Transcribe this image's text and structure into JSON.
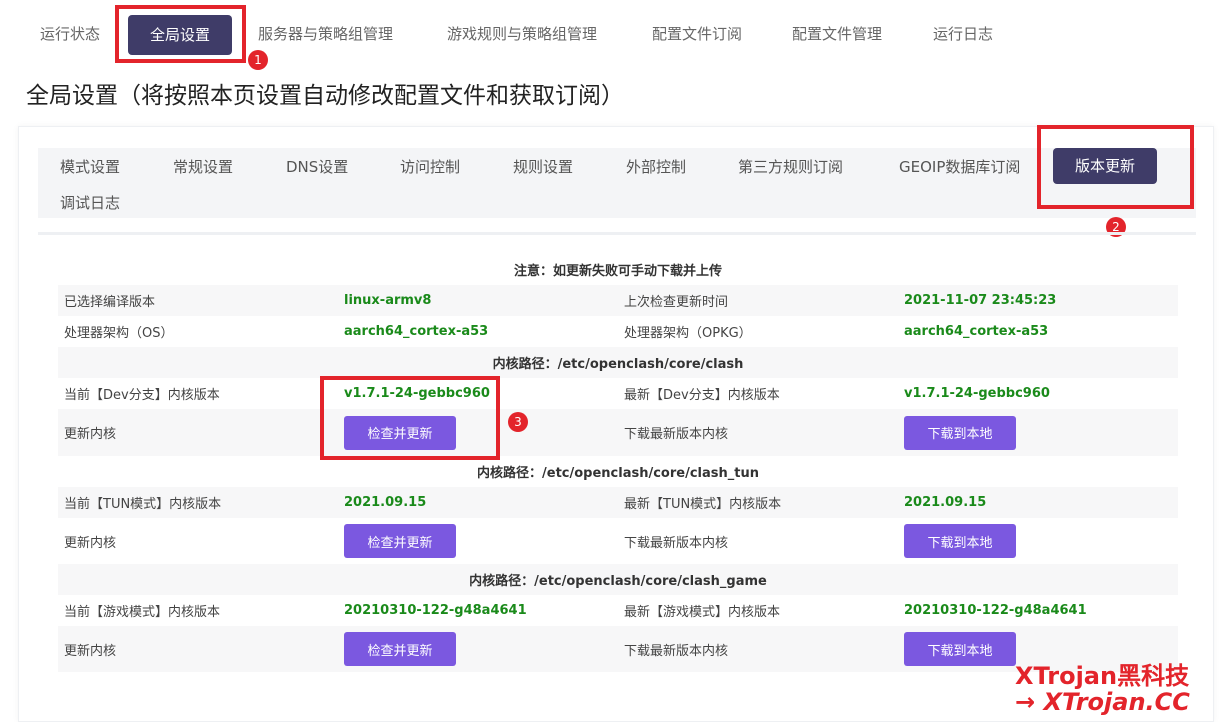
{
  "top_tabs": [
    "运行状态",
    "全局设置",
    "服务器与策略组管理",
    "游戏规则与策略组管理",
    "配置文件订阅",
    "配置文件管理",
    "运行日志"
  ],
  "top_tab_active": "全局设置",
  "page_title": "全局设置（将按照本页设置自动修改配置文件和获取订阅）",
  "sub_tabs": [
    "模式设置",
    "常规设置",
    "DNS设置",
    "访问控制",
    "规则设置",
    "外部控制",
    "第三方规则订阅",
    "GEOIP数据库订阅",
    "版本更新",
    "调试日志"
  ],
  "sub_tab_active": "版本更新",
  "annotations": [
    "1",
    "2",
    "3"
  ],
  "notice": "注意：如更新失败可手动下载并上传",
  "info": {
    "compiled_label": "已选择编译版本",
    "compiled_value": "linux-armv8",
    "last_check_label": "上次检查更新时间",
    "last_check_value": "2021-11-07 23:45:23",
    "arch_os_label": "处理器架构（OS）",
    "arch_os_value": "aarch64_cortex-a53",
    "arch_opkg_label": "处理器架构（OPKG）",
    "arch_opkg_value": "aarch64_cortex-a53"
  },
  "cores": [
    {
      "path_title": "内核路径：/etc/openclash/core/clash",
      "current_label": "当前【Dev分支】内核版本",
      "current_value": "v1.7.1-24-gebbc960",
      "latest_label": "最新【Dev分支】内核版本",
      "latest_value": "v1.7.1-24-gebbc960",
      "update_label": "更新内核",
      "update_button": "检查并更新",
      "download_label": "下载最新版本内核",
      "download_button": "下载到本地"
    },
    {
      "path_title": "内核路径：/etc/openclash/core/clash_tun",
      "current_label": "当前【TUN模式】内核版本",
      "current_value": "2021.09.15",
      "latest_label": "最新【TUN模式】内核版本",
      "latest_value": "2021.09.15",
      "update_label": "更新内核",
      "update_button": "检查并更新",
      "download_label": "下载最新版本内核",
      "download_button": "下载到本地"
    },
    {
      "path_title": "内核路径：/etc/openclash/core/clash_game",
      "current_label": "当前【游戏模式】内核版本",
      "current_value": "20210310-122-g48a4641",
      "latest_label": "最新【游戏模式】内核版本",
      "latest_value": "20210310-122-g48a4641",
      "update_label": "更新内核",
      "update_button": "检查并更新",
      "download_label": "下载最新版本内核",
      "download_button": "下载到本地"
    }
  ],
  "watermark": {
    "line1": "XTrojan黑科技",
    "line2": "→ XTrojan.CC"
  },
  "colors": {
    "active_tab": "#3f3c68",
    "button": "#7b58e0",
    "value_green": "#1a8a1a",
    "annotation_red": "#e3242b"
  }
}
